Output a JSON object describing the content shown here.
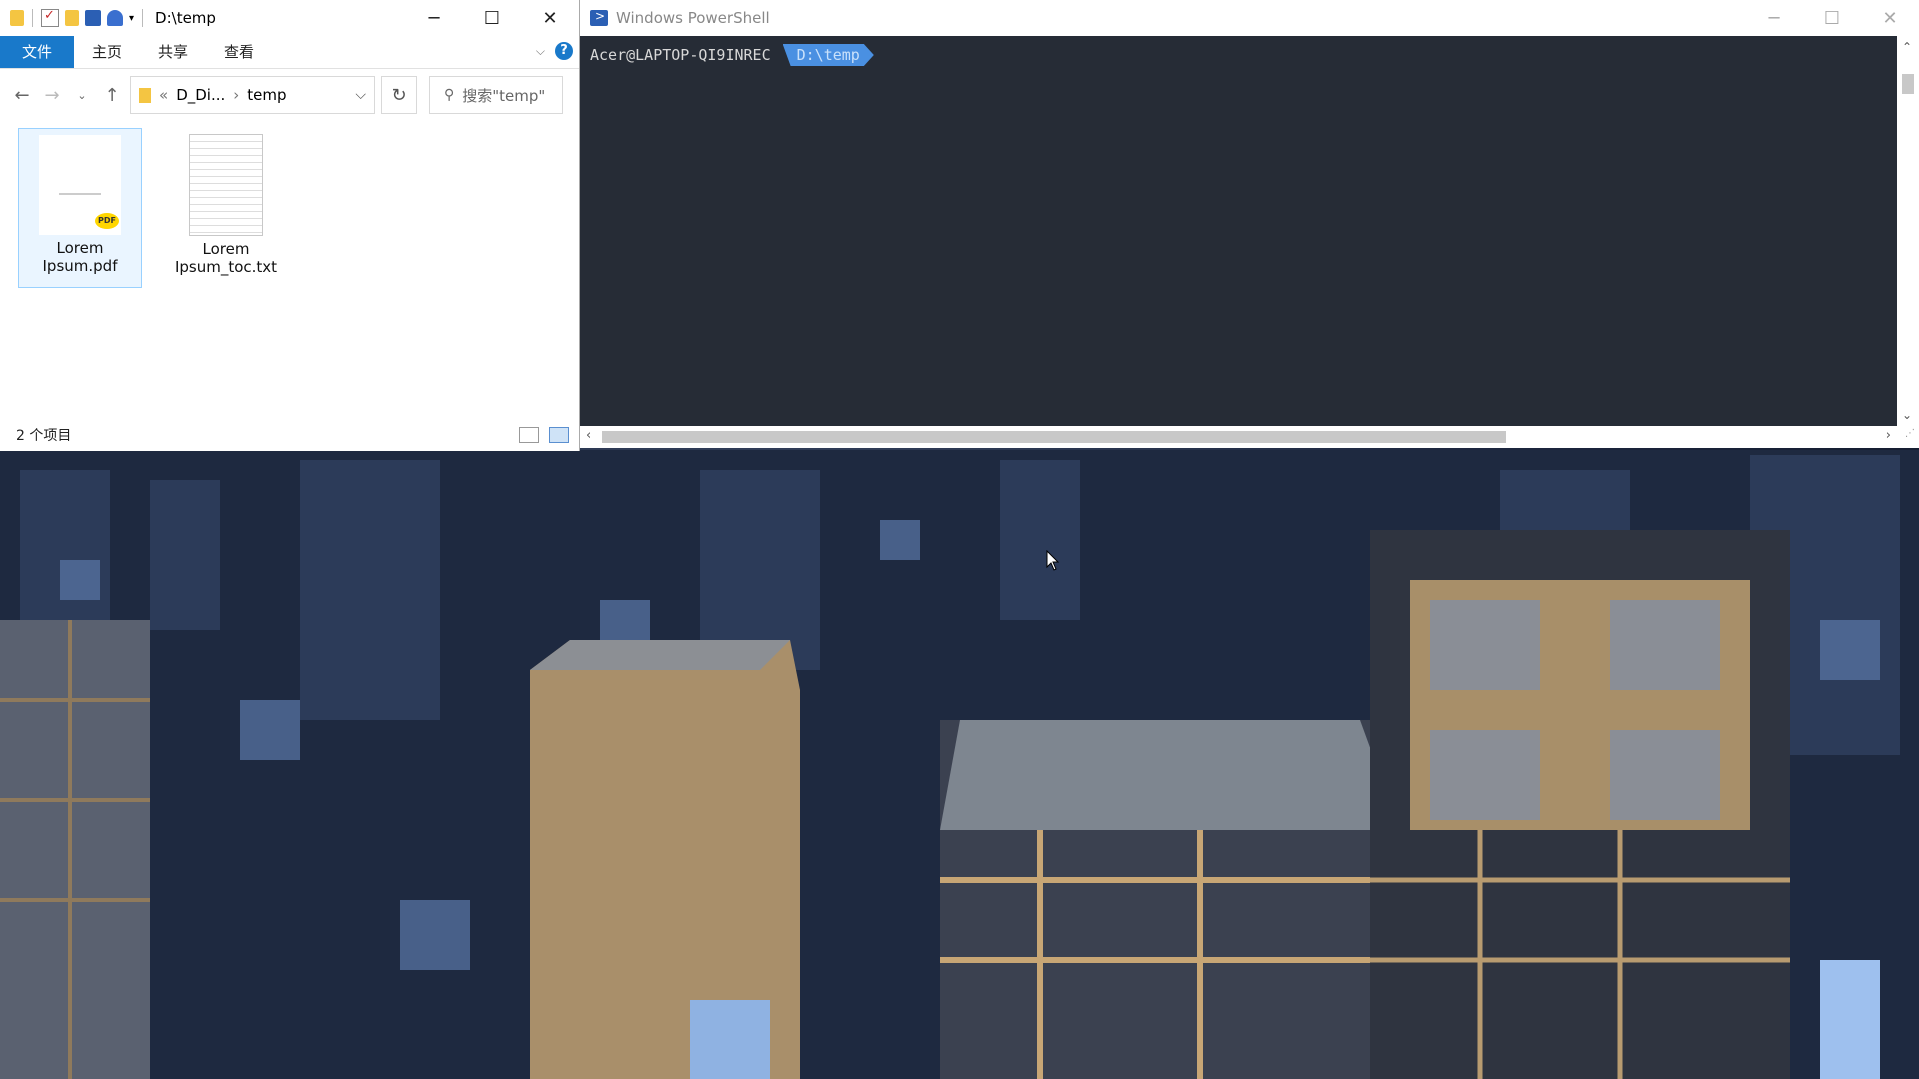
{
  "explorer": {
    "title": "D:\\temp",
    "ribbon_tabs": [
      "文件",
      "主页",
      "共享",
      "查看"
    ],
    "address": {
      "prefix": "«",
      "crumb1": "D_Di...",
      "separator": "›",
      "crumb2": "temp"
    },
    "search_placeholder": "搜索\"temp\"",
    "files": [
      {
        "name": "Lorem Ipsum.pdf",
        "badge": "PDF"
      },
      {
        "name": "Lorem Ipsum_toc.txt"
      }
    ],
    "status_text": "2 个项目"
  },
  "powershell": {
    "title": "Windows PowerShell",
    "prompt_user": "Acer@LAPTOP-QI9INREC",
    "prompt_path": "D:\\temp"
  },
  "colors": {
    "accent": "#1979ca",
    "ps_background": "#262c36",
    "prompt_path_bg": "#4a90e2"
  }
}
